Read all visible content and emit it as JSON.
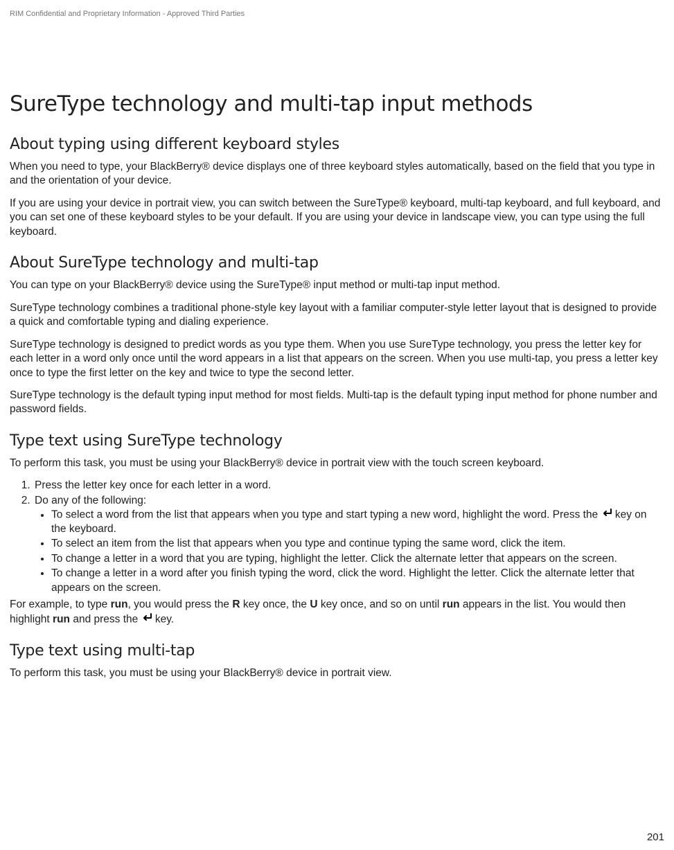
{
  "header": {
    "confidential": "RIM Confidential and Proprietary Information - Approved Third Parties"
  },
  "title": "SureType technology and multi-tap input methods",
  "sec1": {
    "h": "About typing using different keyboard styles",
    "p1": "When you need to type, your BlackBerry® device displays one of three keyboard styles automatically, based on the field that you type in and the orientation of your device.",
    "p2": "If you are using your device in portrait view, you can switch between the SureType® keyboard, multi-tap keyboard, and full keyboard, and you can set one of these keyboard styles to be your default. If you are using your device in landscape view, you can type using the full keyboard."
  },
  "sec2": {
    "h": "About SureType technology and multi-tap",
    "p1": "You can type on your BlackBerry® device using the SureType® input method or multi-tap input method.",
    "p2": "SureType technology combines a traditional phone-style key layout with a familiar computer-style letter layout that is designed to provide a quick and comfortable typing and dialing experience.",
    "p3": "SureType technology is designed to predict words as you type them. When you use SureType technology, you press the letter key for each letter in a word only once until the word appears in a list that appears on the screen. When you use multi-tap, you press a letter key once to type the first letter on the key and twice to type the second letter.",
    "p4": "SureType technology is the default typing input method for most fields. Multi-tap is the default typing input method for phone number and password fields."
  },
  "sec3": {
    "h": "Type text using SureType technology",
    "intro": "To perform this task, you must be using your BlackBerry® device in portrait view with the touch screen keyboard.",
    "step1": "Press the letter key once for each letter in a word.",
    "step2": "Do any of the following:",
    "b1a": "To select a word from the list that appears when you type and start typing a new word, highlight the word. Press the ",
    "b1b": " key on the keyboard.",
    "b2": "To select an item from the list that appears when you type and continue typing the same word, click the item.",
    "b3": "To change a letter in a word that you are typing, highlight the letter. Click the alternate letter that appears on the screen.",
    "b4": "To change a letter in a word after you finish typing the word, click the word. Highlight the letter. Click the alternate letter that appears on the screen.",
    "ex1": "For example, to type ",
    "ex_run": "run",
    "ex2": ", you would press the ",
    "ex_R": "R",
    "ex3": " key once, the ",
    "ex_U": "U",
    "ex4": " key once, and so on until ",
    "ex5": " appears in the list. You would then highlight ",
    "ex6": " and press the ",
    "ex7": " key."
  },
  "sec4": {
    "h": "Type text using multi-tap",
    "p1": "To perform this task, you must be using your BlackBerry® device in portrait view."
  },
  "pagenum": "201"
}
